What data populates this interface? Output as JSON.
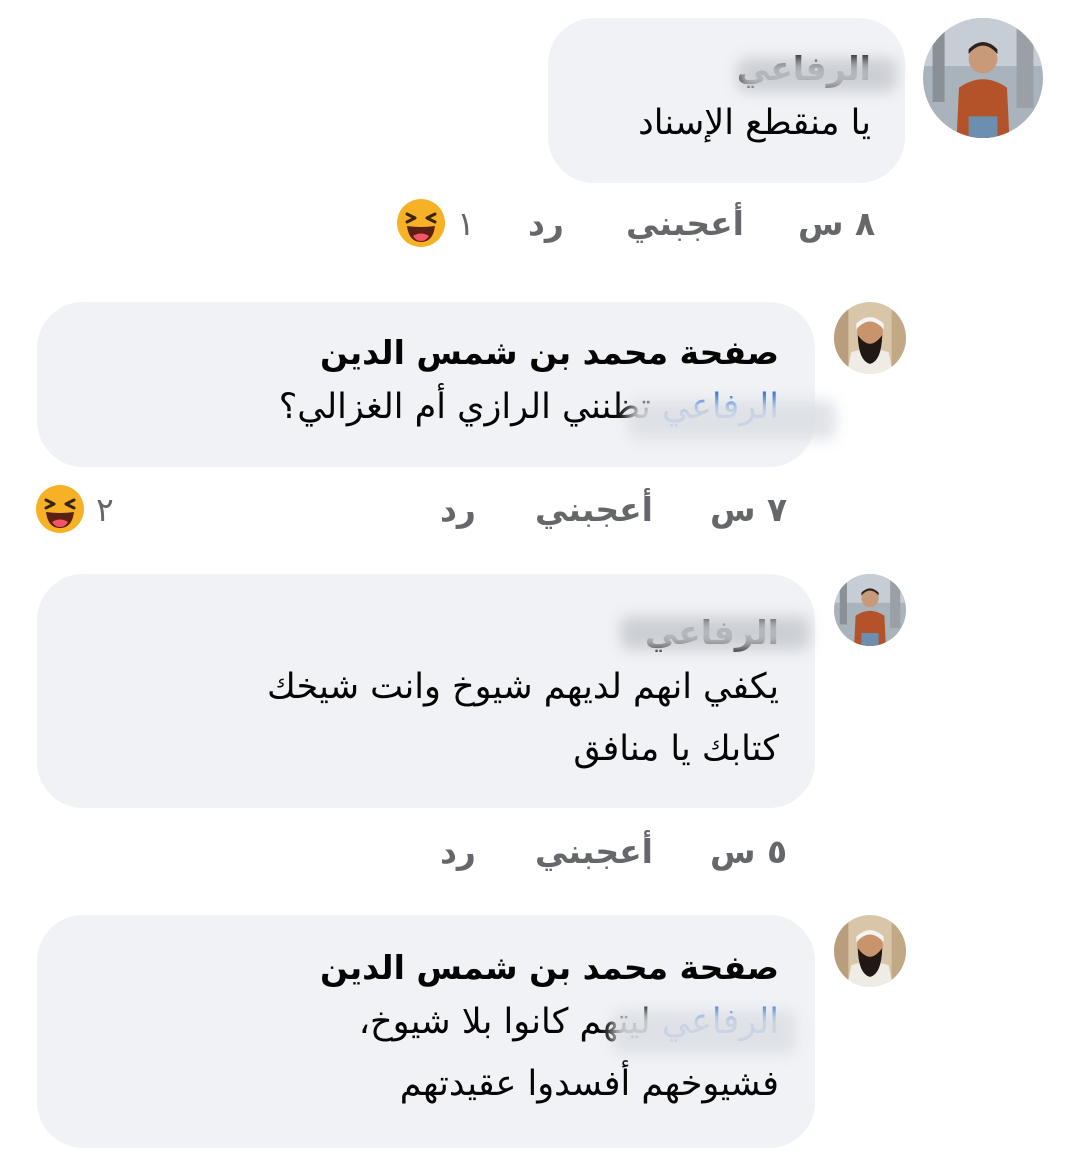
{
  "comments": [
    {
      "author": "الرفاعي",
      "text": "يا منقطع الإسناد",
      "meta": {
        "time": "٨ س",
        "like": "أعجبني",
        "reply": "رد",
        "reaction_count": "١"
      }
    },
    {
      "author": "صفحة محمد بن شمس الدين",
      "mention": "الرفاعي",
      "text": "تظنني الرازي أم الغزالي؟",
      "meta": {
        "time": "٧ س",
        "like": "أعجبني",
        "reply": "رد",
        "reaction_count": "٢"
      }
    },
    {
      "author": "الرفاعي",
      "text_lines": [
        "يكفي انهم لديهم شيوخ وانت شيخك",
        "كتابك يا منافق"
      ],
      "meta": {
        "time": "٥ س",
        "like": "أعجبني",
        "reply": "رد"
      }
    },
    {
      "author": "صفحة محمد بن شمس الدين",
      "mention": "الرفاعي",
      "text_line1": "ليتهم كانوا بلا شيوخ،",
      "text_line2": "فشيوخهم أفسدوا عقيدتهم"
    }
  ],
  "icons": {
    "reaction": "laughing-face-icon",
    "avatar_young_man": "avatar-young-man",
    "avatar_sheikh": "avatar-sheikh"
  },
  "colors": {
    "bubble": "#f0f2f5",
    "mention": "#216fdb",
    "meta": "#65676b",
    "emoji": "#f7b125"
  }
}
